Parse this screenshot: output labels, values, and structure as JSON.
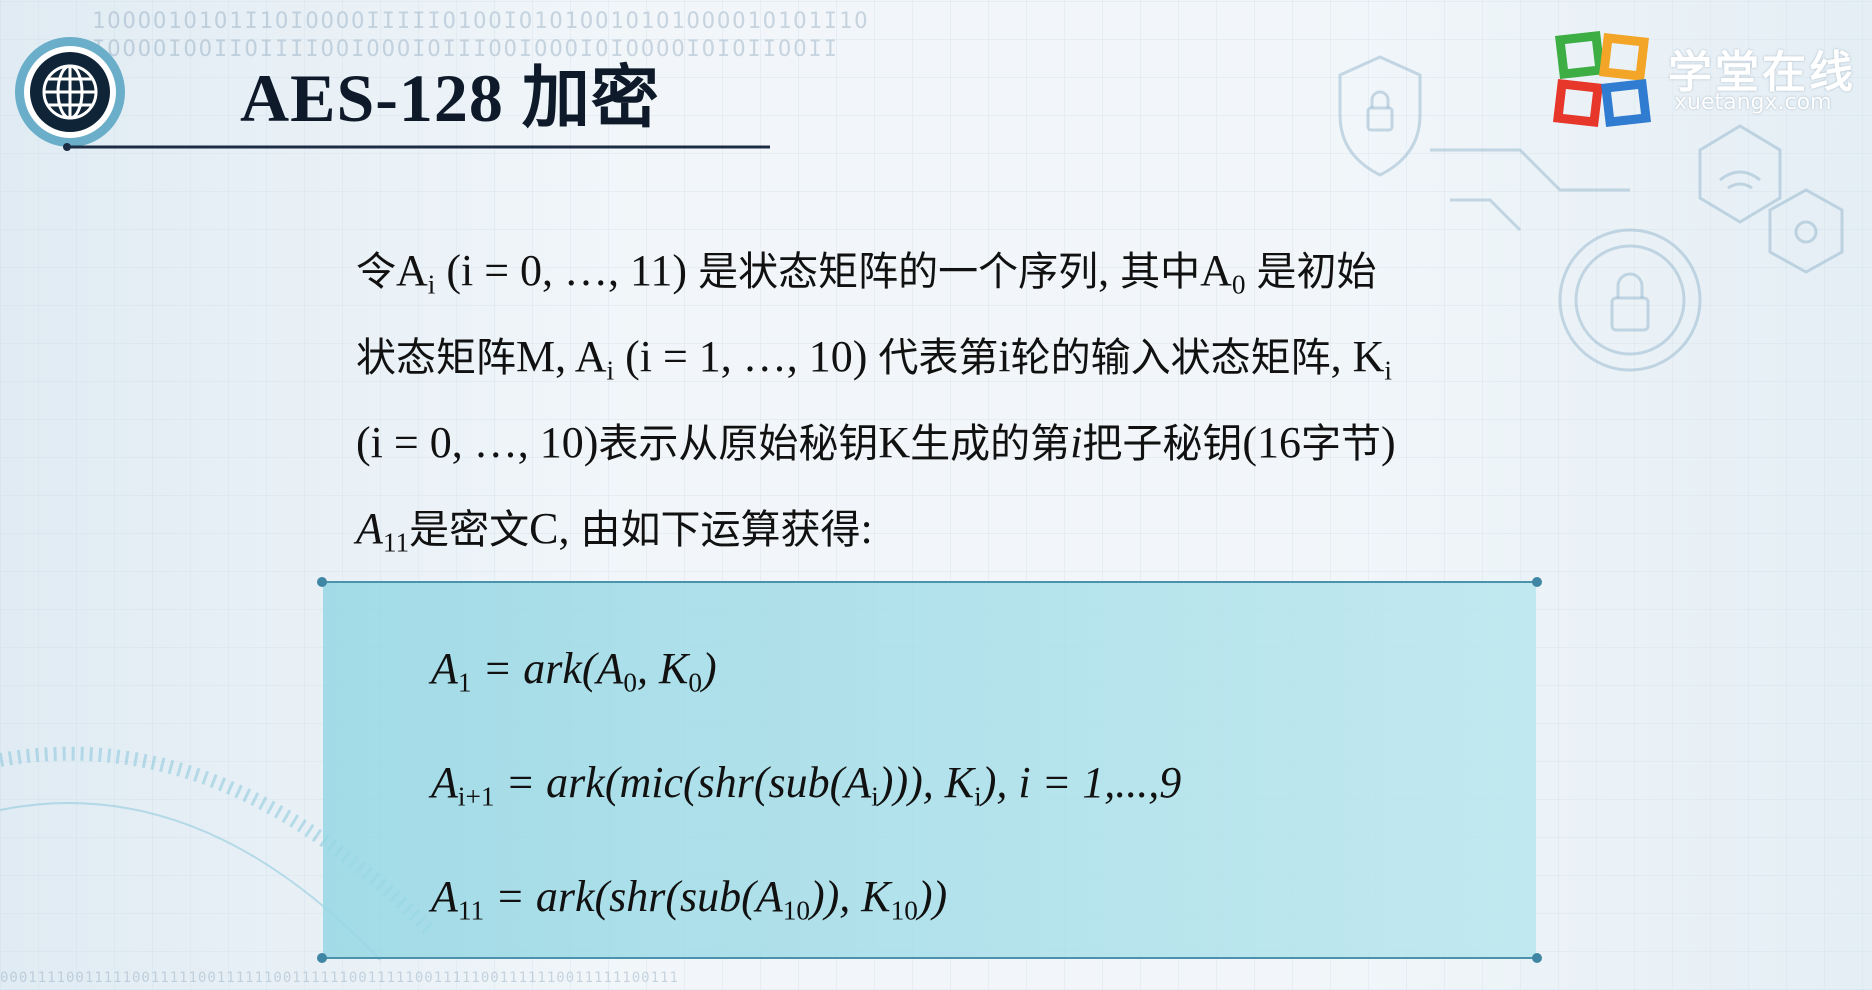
{
  "header": {
    "title": "AES-128 加密"
  },
  "logo": {
    "name_cn": "学堂在线",
    "name_en": "xuetangx.com",
    "colors": [
      "#3cae44",
      "#f2a526",
      "#e7362a",
      "#2f7cd1"
    ]
  },
  "decor": {
    "binary_top": "1OOOO1O1O1I1OIOOOOIIIIIO1OOIO1O1OO1O1O1OOOO1O1O1I1O",
    "binary_top2": "IOOOOIOOIIOIIIIOOIOOOIOIIIOOIOOOIOIOOOOIOIOIIOOII",
    "binary_bottom": "000111100111110011111001111110011111100111110011111001111110011111100111"
  },
  "body": {
    "line1": [
      {
        "t": "令",
        "cn": true
      },
      {
        "t": "A"
      },
      {
        "sub": "i"
      },
      {
        "t": " (i = 0, …, 11) "
      },
      {
        "t": "是状态矩阵的一个序列",
        "cn": true
      },
      {
        "t": ", "
      },
      {
        "t": "其中",
        "cn": true
      },
      {
        "t": "A"
      },
      {
        "sub": "0"
      },
      {
        "t": " "
      },
      {
        "t": "是初始",
        "cn": true
      }
    ],
    "line2": [
      {
        "t": "状态矩阵",
        "cn": true
      },
      {
        "t": "M,  A"
      },
      {
        "sub": "i"
      },
      {
        "t": " (i = 1, …, 10) "
      },
      {
        "t": "代表第",
        "cn": true
      },
      {
        "t": "i"
      },
      {
        "t": "轮的输入状态矩阵",
        "cn": true
      },
      {
        "t": ", K"
      },
      {
        "sub": "i"
      }
    ],
    "line3": [
      {
        "t": "(i = 0, …, 10)"
      },
      {
        "t": "表示从原始秘钥",
        "cn": true
      },
      {
        "t": "K"
      },
      {
        "t": "生成的第",
        "cn": true
      },
      {
        "t": "i",
        "it": true
      },
      {
        "t": "把子秘钥",
        "cn": true
      },
      {
        "t": "(16"
      },
      {
        "t": "字节",
        "cn": true
      },
      {
        "t": ")"
      }
    ],
    "line4": [
      {
        "t": " A",
        "it": true
      },
      {
        "sub": "11"
      },
      {
        "t": "是密文",
        "cn": true
      },
      {
        "t": "C, "
      },
      {
        "t": "由如下运算获得",
        "cn": true
      },
      {
        "t": ":"
      }
    ]
  },
  "formulas": [
    [
      {
        "t": "A"
      },
      {
        "sub": "1"
      },
      {
        "t": " = ark(A"
      },
      {
        "sub": "0"
      },
      {
        "t": ", K"
      },
      {
        "sub": "0"
      },
      {
        "t": ")"
      }
    ],
    [
      {
        "t": "A"
      },
      {
        "sub": "i+1"
      },
      {
        "t": " = ark(mic(shr(sub(A"
      },
      {
        "sub": "i"
      },
      {
        "t": "))), K"
      },
      {
        "sub": "i"
      },
      {
        "t": "), i = 1,...,9"
      }
    ],
    [
      {
        "t": "A"
      },
      {
        "sub": "11"
      },
      {
        "t": " = ark(shr(sub(A"
      },
      {
        "sub": "10"
      },
      {
        "t": ")), K"
      },
      {
        "sub": "10"
      },
      {
        "t": "))"
      }
    ]
  ]
}
